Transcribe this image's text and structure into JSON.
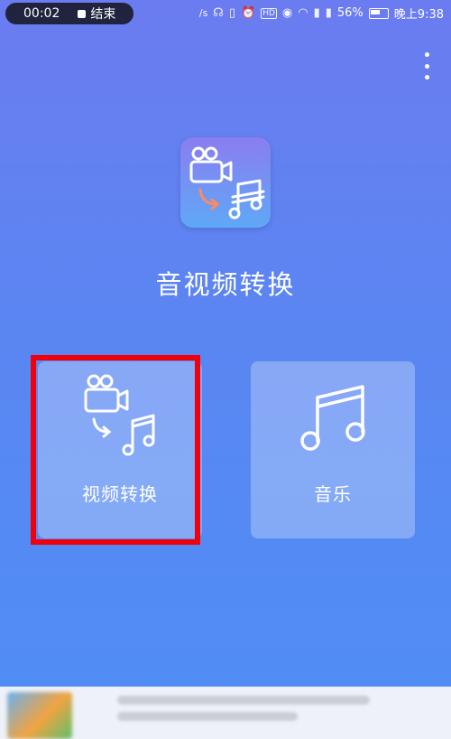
{
  "status_bar": {
    "record_time": "00:02",
    "record_stop_label": "结束",
    "net_speed": "/s",
    "battery": "56%",
    "clock": "晚上9:38"
  },
  "app": {
    "title": "音视频转换"
  },
  "cards": [
    {
      "label": "视频转换",
      "icon": "video-to-music-icon"
    },
    {
      "label": "音乐",
      "icon": "music-note-icon"
    }
  ],
  "colors": {
    "background_top": "#6b7cf0",
    "background_bottom": "#4f8ef5",
    "highlight": "#f0000c"
  }
}
